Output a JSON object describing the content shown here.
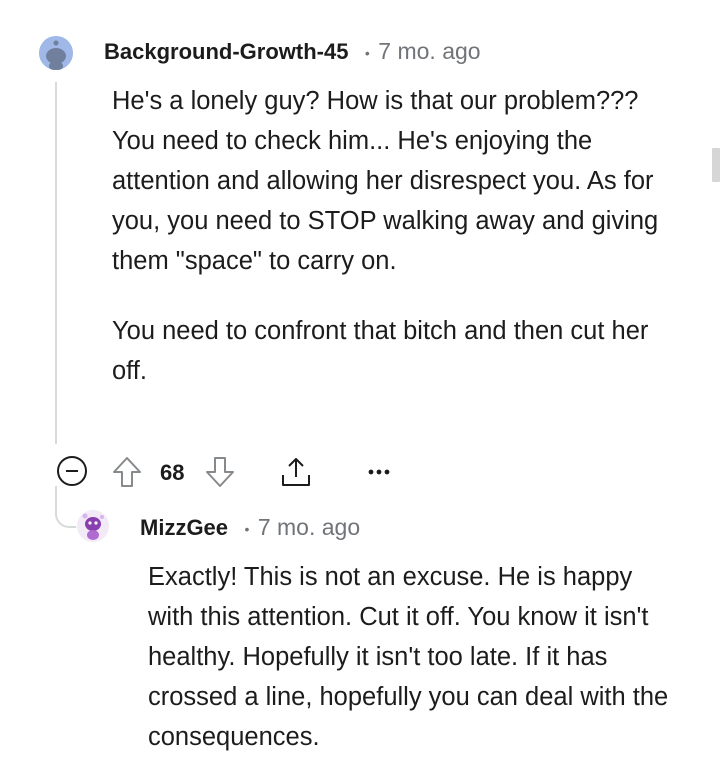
{
  "comments": [
    {
      "username": "Background-Growth-45",
      "separator": "•",
      "age": "7 mo. ago",
      "paragraphs": [
        "He's a lonely guy? How is that our problem??? You need to check him... He's enjoying the attention and allowing her disrespect you. As for you, you need to STOP walking away and giving them \"space\" to carry on.",
        "You need to confront that bitch and then cut her off."
      ],
      "votes": "68"
    },
    {
      "username": "MizzGee",
      "separator": "•",
      "age": "7 mo. ago",
      "paragraphs": [
        "Exactly! This is not an excuse. He is happy with this attention. Cut it off. You know it isn't healthy. Hopefully it isn't too late. If it has crossed a line, hopefully you can deal with the consequences."
      ]
    }
  ],
  "icons": {
    "collapse": "collapse-icon",
    "upvote": "upvote-arrow-icon",
    "downvote": "downvote-arrow-icon",
    "share": "share-icon",
    "more": "more-options-icon"
  },
  "colors": {
    "text": "#1c1c1c",
    "meta": "#707478",
    "thread_line": "#d7dadc",
    "avatar_blue": "#9fb8e8",
    "avatar_purple": "#8a3fb0"
  }
}
